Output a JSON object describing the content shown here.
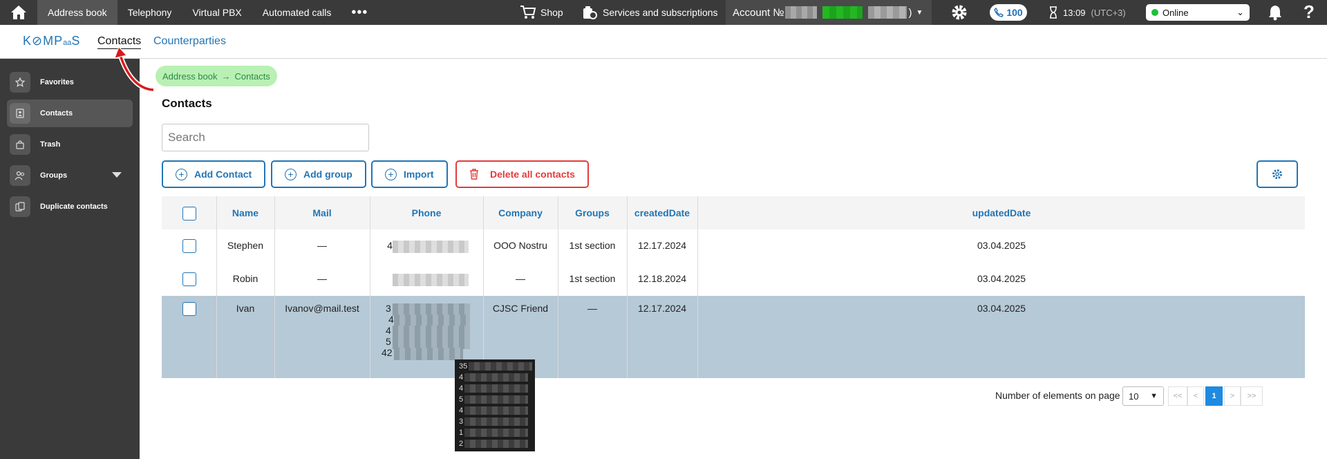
{
  "topbar": {
    "nav": [
      "Address book",
      "Telephony",
      "Virtual PBX",
      "Automated calls"
    ],
    "more": "•••",
    "shop": "Shop",
    "services": "Services and subscriptions",
    "account_label": "Account №",
    "account_suffix": ")",
    "balance": "100",
    "time": "13:09",
    "timezone": "(UTC+3)",
    "status": "Online",
    "help": "?"
  },
  "subheader": {
    "logo_a": "K",
    "logo_b": "MP",
    "logo_c": "aa",
    "logo_d": "S",
    "tabs": [
      "Contacts",
      "Counterparties"
    ]
  },
  "sidebar": {
    "items": [
      "Favorites",
      "Contacts",
      "Trash",
      "Groups",
      "Duplicate contacts"
    ]
  },
  "breadcrumb": {
    "parent": "Address book",
    "arrow": "→",
    "current": "Contacts"
  },
  "page_title": "Contacts",
  "search": {
    "placeholder": "Search",
    "value": ""
  },
  "buttons": {
    "add_contact": "Add Contact",
    "add_group": "Add group",
    "import": "Import",
    "delete_all": "Delete all contacts"
  },
  "table": {
    "columns": [
      "Name",
      "Mail",
      "Phone",
      "Company",
      "Groups",
      "createdDate",
      "updatedDate"
    ],
    "rows": [
      {
        "name": "Stephen",
        "mail": "—",
        "phone": "4",
        "company": "OOO Nostru",
        "groups": "1st section",
        "created": "12.17.2024",
        "updated": "03.04.2025"
      },
      {
        "name": "Robin",
        "mail": "—",
        "phone": "",
        "company": "—",
        "groups": "1st section",
        "created": "12.18.2024",
        "updated": "03.04.2025"
      },
      {
        "name": "Ivan",
        "mail": "Ivanov@mail.test",
        "phone": [
          "3",
          "4",
          "4",
          "5",
          "42"
        ],
        "company": "CJSC Friend",
        "groups": "—",
        "created": "12.17.2024",
        "updated": "03.04.2025"
      }
    ]
  },
  "tooltip": {
    "lines": [
      "35",
      "4",
      "4",
      "5",
      "4",
      "3",
      "1",
      "2"
    ]
  },
  "pagination": {
    "label": "Number of elements on page",
    "per_page": "10",
    "first": "<<",
    "prev": "<",
    "current": "1",
    "next": ">",
    "last": ">>"
  },
  "colors": {
    "accent": "#2275b5",
    "danger": "#e33b3b",
    "selected_row": "#b6c9d6",
    "topbar": "#3a3a3a",
    "online": "#1fbe38"
  }
}
